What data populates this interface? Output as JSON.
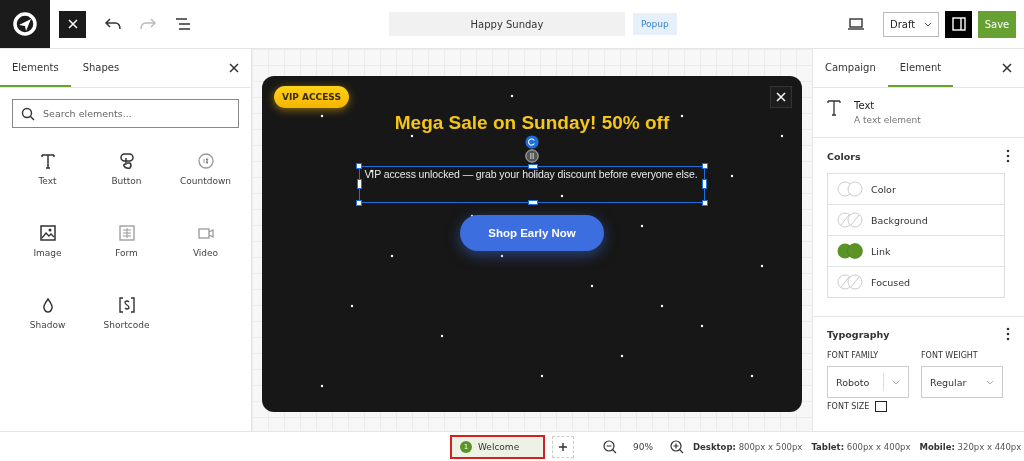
{
  "toolbar": {
    "title": "Happy Sunday",
    "type_badge": "Popup",
    "status": "Draft",
    "save": "Save",
    "redo_disabled": true
  },
  "left_panel": {
    "tabs": [
      {
        "label": "Elements",
        "selected": true
      },
      {
        "label": "Shapes",
        "selected": false
      }
    ],
    "search": {
      "placeholder": "Search elements..."
    },
    "elements": [
      {
        "kind": "text",
        "label": "Text"
      },
      {
        "kind": "button",
        "label": "Button"
      },
      {
        "kind": "countdown",
        "label": "Countdown"
      },
      {
        "kind": "image",
        "label": "Image"
      },
      {
        "kind": "form",
        "label": "Form"
      },
      {
        "kind": "video",
        "label": "Video"
      },
      {
        "kind": "shadow",
        "label": "Shadow"
      },
      {
        "kind": "shortcode",
        "label": "Shortcode"
      }
    ]
  },
  "popup": {
    "badge": "VIP ACCESS",
    "heading": "Mega Sale on Sunday! 50% off",
    "body": "VIP access unlocked — grab your holiday discount before everyone else.",
    "cta": "Shop Early Now",
    "body_selected": true
  },
  "right_panel": {
    "tabs": [
      {
        "label": "Campaign",
        "selected": false
      },
      {
        "label": "Element",
        "selected": true
      }
    ],
    "element": {
      "name": "Text",
      "description": "A text element"
    },
    "colors": {
      "title": "Colors",
      "items": [
        {
          "kind": "outline",
          "label": "Color"
        },
        {
          "kind": "slashed",
          "label": "Background"
        },
        {
          "kind": "filled",
          "label": "Link",
          "color": "#5b9327"
        },
        {
          "kind": "slashed",
          "label": "Focused"
        }
      ]
    },
    "typography": {
      "title": "Typography",
      "font_family_label": "FONT FAMILY",
      "font_family": "Roboto",
      "font_weight_label": "FONT WEIGHT",
      "font_weight": "Regular",
      "font_size_label": "FONT SIZE"
    }
  },
  "bottom_bar": {
    "pages": [
      {
        "number": "1",
        "name": "Welcome",
        "selected": true,
        "highlighted": true
      }
    ],
    "zoom": "90%",
    "sizes": [
      {
        "device": "Desktop:",
        "size": "800px x 500px"
      },
      {
        "device": "Tablet:",
        "size": "600px x 400px"
      },
      {
        "device": "Mobile:",
        "size": "320px x 440px"
      }
    ]
  }
}
